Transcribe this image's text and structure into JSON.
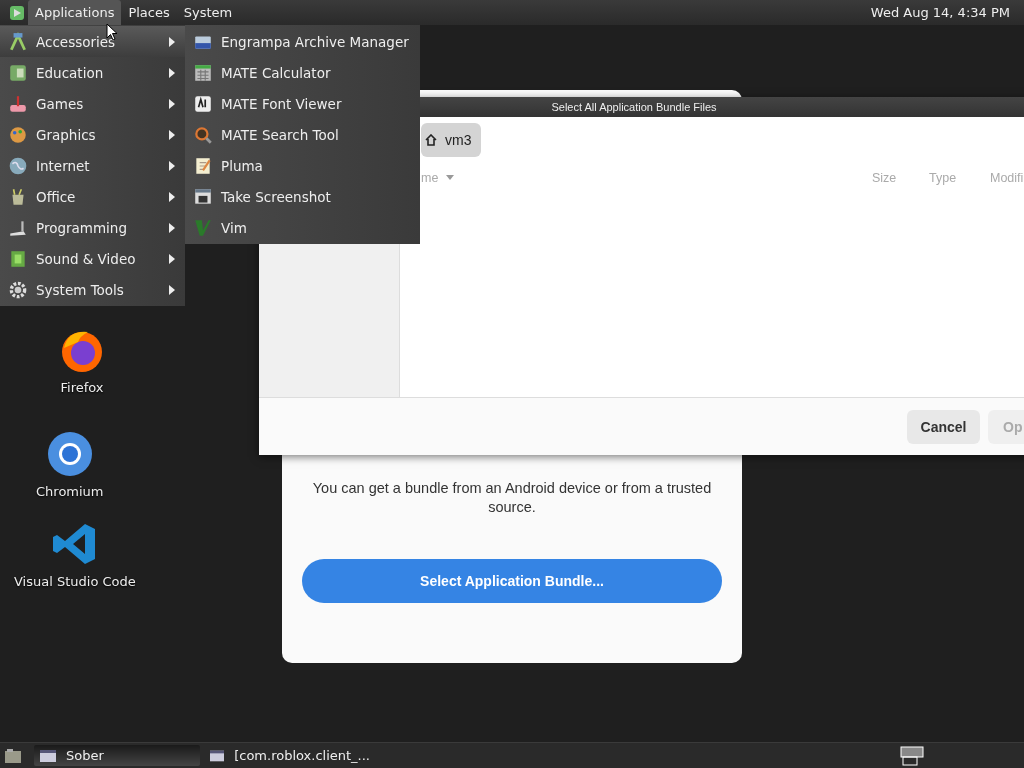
{
  "top_panel": {
    "menus": [
      {
        "label": "Applications",
        "selected": true
      },
      {
        "label": "Places",
        "selected": false
      },
      {
        "label": "System",
        "selected": false
      }
    ],
    "clock": "Wed Aug 14,  4:34 PM"
  },
  "applications_menu": {
    "items": [
      {
        "label": "Accessories",
        "selected": true
      },
      {
        "label": "Education",
        "selected": false
      },
      {
        "label": "Games",
        "selected": false
      },
      {
        "label": "Graphics",
        "selected": false
      },
      {
        "label": "Internet",
        "selected": false
      },
      {
        "label": "Office",
        "selected": false
      },
      {
        "label": "Programming",
        "selected": false
      },
      {
        "label": "Sound & Video",
        "selected": false
      },
      {
        "label": "System Tools",
        "selected": false
      }
    ],
    "submenu": [
      "Engrampa Archive Manager",
      "MATE Calculator",
      "MATE Font Viewer",
      "MATE Search Tool",
      "Pluma",
      "Take Screenshot",
      "Vim"
    ]
  },
  "desktop_icons": [
    "Firefox",
    "Chromium",
    "Visual Studio Code"
  ],
  "sober_window": {
    "hint": "You can get a bundle from an Android device or from a trusted source.",
    "button": "Select Application Bundle..."
  },
  "file_dialog": {
    "title": "Select All Application Bundle Files",
    "path": "vm3",
    "columns": [
      "me",
      "Size",
      "Type",
      "Modifi"
    ],
    "buttons": [
      {
        "label": "Cancel",
        "disabled": false
      },
      {
        "label": "Op",
        "disabled": true
      }
    ]
  },
  "taskbar": {
    "tasks": [
      {
        "label": "Sober",
        "selected": true
      },
      {
        "label": "[com.roblox.client_...",
        "selected": false
      }
    ]
  }
}
